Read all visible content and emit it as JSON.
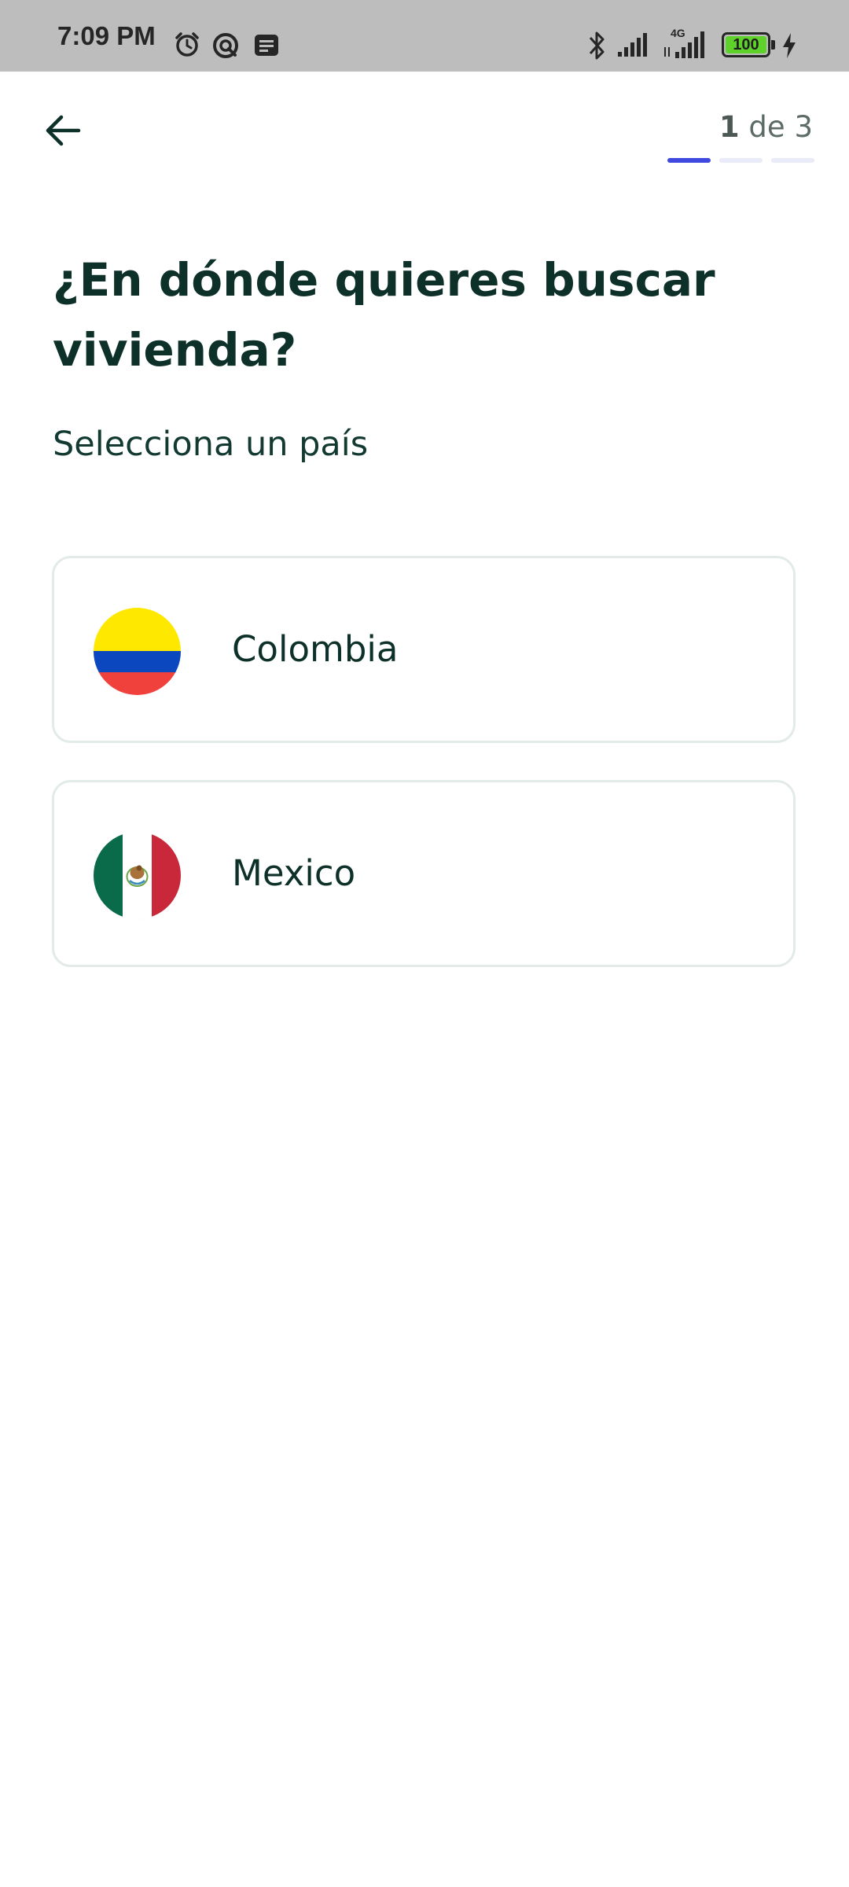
{
  "status_bar": {
    "time": "7:09 PM",
    "network_label": "4G",
    "battery_level": "100",
    "icons": [
      "alarm-icon",
      "data-saver-icon",
      "notification-icon",
      "bluetooth-icon",
      "signal-icon",
      "signal-4g-icon",
      "battery-icon",
      "charging-icon"
    ]
  },
  "header": {
    "back_icon": "arrow-left-icon",
    "step_current": "1",
    "step_rest": " de 3",
    "progress_steps_total": 3,
    "progress_step_active": 1,
    "colors": {
      "active": "#3f49e0",
      "inactive": "#e9ebf8"
    }
  },
  "main": {
    "title": "¿En dónde quieres buscar vivienda?",
    "subtitle": "Selecciona un país",
    "countries": [
      {
        "name": "Colombia",
        "flag_icon": "colombia-flag-icon"
      },
      {
        "name": "Mexico",
        "flag_icon": "mexico-flag-icon"
      }
    ]
  },
  "colors": {
    "text_primary": "#0d3028",
    "card_border": "#e3ebe9",
    "status_bar_bg": "#bdbdbd"
  }
}
